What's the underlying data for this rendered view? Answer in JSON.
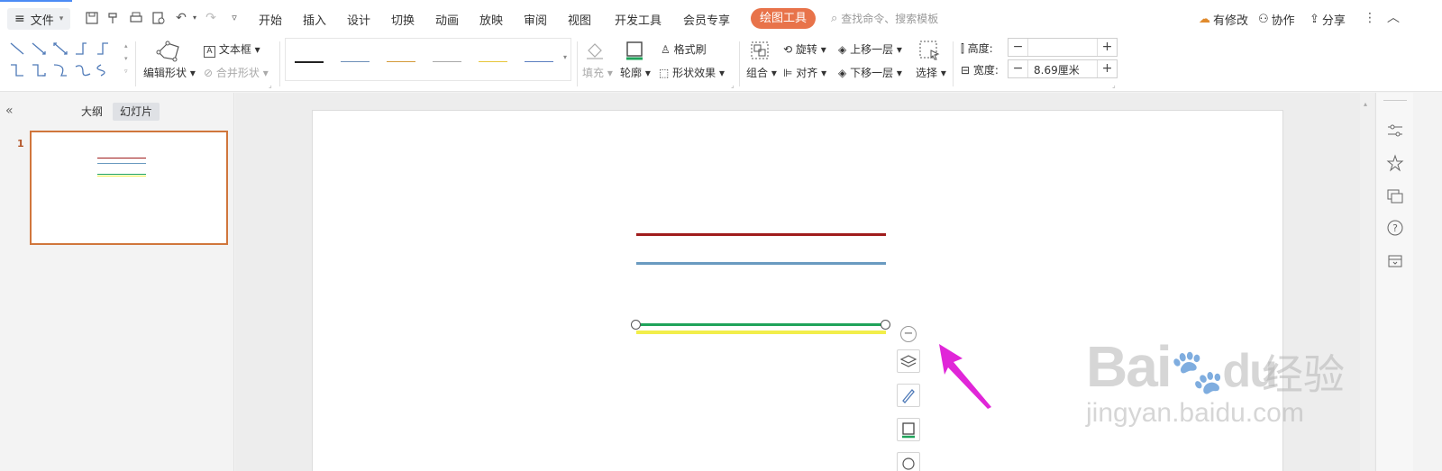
{
  "menubar": {
    "file_label": "文件",
    "tabs": [
      "开始",
      "插入",
      "设计",
      "切换",
      "动画",
      "放映",
      "审阅",
      "视图",
      "开发工具",
      "会员专享"
    ],
    "active_tab": "绘图工具",
    "search_placeholder": "查找命令、搜索模板",
    "modified_label": "有修改",
    "collab_label": "协作",
    "share_label": "分享"
  },
  "ribbon": {
    "textbox_label": "文本框",
    "edit_shape_label": "编辑形状",
    "merge_shape_label": "合并形状",
    "fill_label": "填充",
    "outline_label": "轮廓",
    "format_painter_label": "格式刷",
    "shape_effects_label": "形状效果",
    "group_label": "组合",
    "rotate_label": "旋转",
    "align_label": "对齐",
    "bring_forward_label": "上移一层",
    "send_backward_label": "下移一层",
    "select_label": "选择",
    "height_label": "高度:",
    "height_value": "",
    "width_label": "宽度:",
    "width_value": "8.69厘米",
    "line_style_colors": [
      "#222222",
      "#6d8fb8",
      "#d49a3a",
      "#a9a9a9",
      "#e7c53a",
      "#5b7fc0"
    ]
  },
  "leftpane": {
    "outline_tab": "大纲",
    "slides_tab": "幻灯片",
    "slide_number": "1"
  },
  "slide": {
    "line_colors": {
      "red": "#a01c1c",
      "blue": "#6a9ac0",
      "green": "#1fa35a",
      "yellow": "#f2ee4a"
    }
  },
  "watermark": {
    "brand": "Bai",
    "brand_cn": "经验",
    "url": "jingyan.baidu.com"
  },
  "annotation_color": "#e026d8"
}
